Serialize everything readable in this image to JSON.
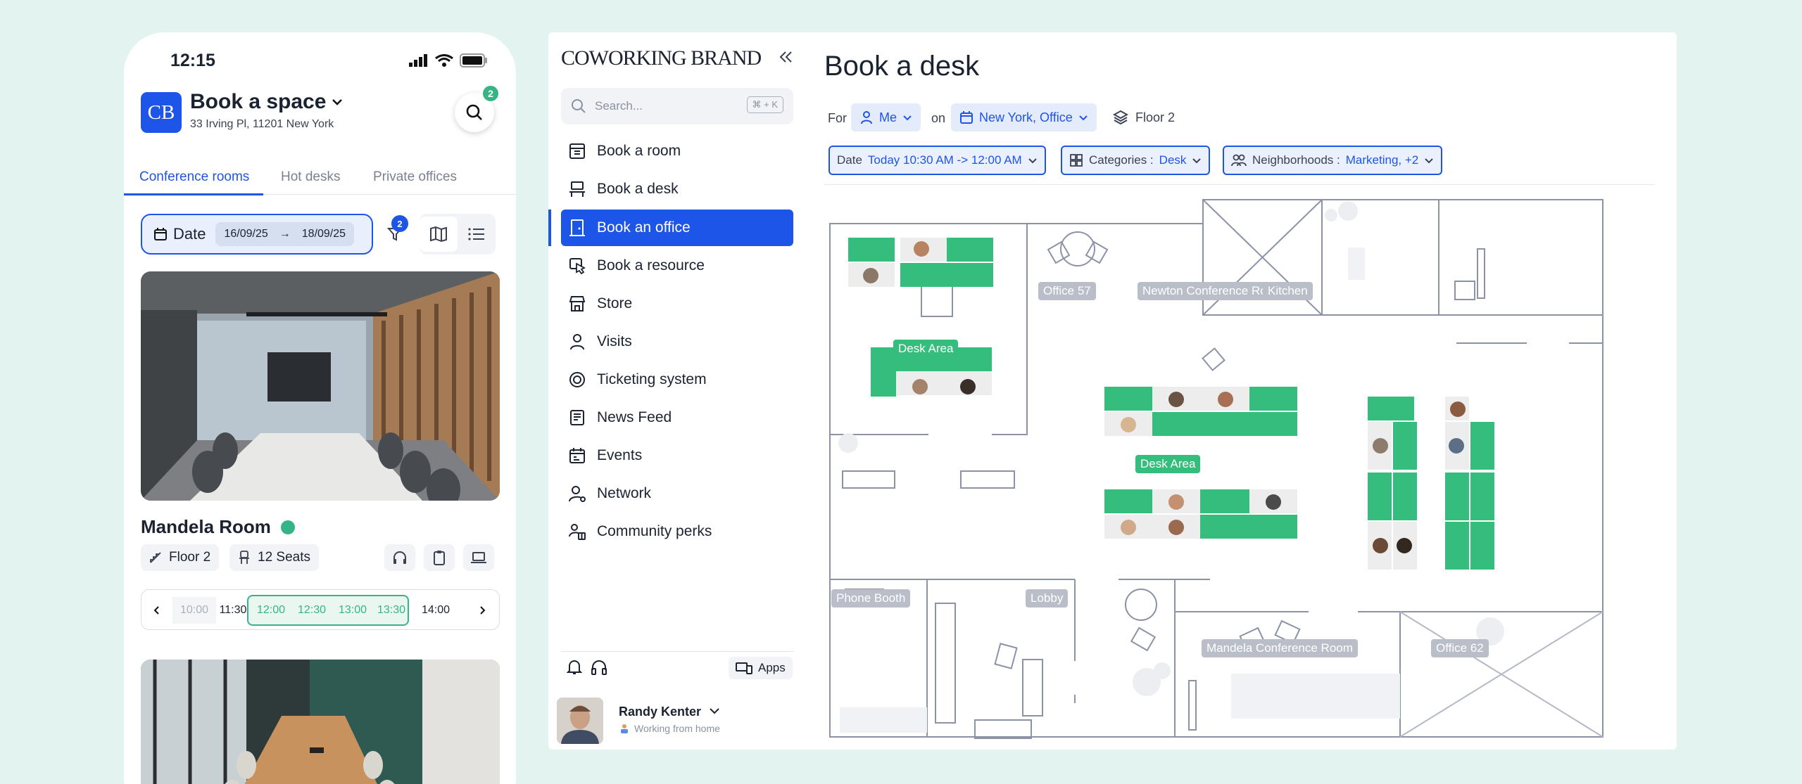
{
  "phone": {
    "time": "12:15",
    "logo": "CB",
    "title": "Book a space",
    "address": "33 Irving Pl, 11201 New York",
    "search_badge": "2",
    "tabs": [
      {
        "label": "Conference rooms",
        "active": true
      },
      {
        "label": "Hot desks",
        "active": false
      },
      {
        "label": "Private offices",
        "active": false
      }
    ],
    "date_label": "Date",
    "date_from": "16/09/25",
    "date_arrow": "→",
    "date_to": "18/09/25",
    "filter_badge": "2",
    "room": {
      "name": "Mandela Room",
      "floor": "Floor 2",
      "seats": "12 Seats"
    },
    "time_slots": [
      "10:00",
      "11:30",
      "12:00",
      "12:30",
      "13:00",
      "13:30",
      "14:00"
    ],
    "selected_slots": [
      "12:00",
      "12:30",
      "13:00",
      "13:30"
    ],
    "colors": {
      "accent": "#1d55e8",
      "available": "#35b585"
    }
  },
  "sidebar": {
    "brand": "COWORKING BRAND",
    "search_placeholder": "Search...",
    "search_shortcut": "⌘ + K",
    "items": [
      {
        "label": "Book a room",
        "icon": "calendar-grid-icon"
      },
      {
        "label": "Book a desk",
        "icon": "desk-icon"
      },
      {
        "label": "Book an office",
        "icon": "door-icon",
        "active": true
      },
      {
        "label": "Book a resource",
        "icon": "hand-pointer-icon"
      },
      {
        "label": "Store",
        "icon": "store-icon"
      },
      {
        "label": "Visits",
        "icon": "user-icon"
      },
      {
        "label": "Ticketing system",
        "icon": "lifebuoy-icon"
      },
      {
        "label": "News Feed",
        "icon": "newspaper-icon"
      },
      {
        "label": "Events",
        "icon": "calendar-icon"
      },
      {
        "label": "Network",
        "icon": "user-network-icon"
      },
      {
        "label": "Community perks",
        "icon": "gift-people-icon"
      }
    ],
    "apps_label": "Apps",
    "user": {
      "name": "Randy Kenter",
      "status": "Working from home"
    }
  },
  "main": {
    "title": "Book a desk",
    "filters": {
      "for_label": "For",
      "for_value": "Me",
      "on_label": "on",
      "location": "New York, Office",
      "floor": "Floor 2",
      "date_label": "Date",
      "date_value": "Today 10:30 AM -> 12:00 AM",
      "categories_label": "Categories :",
      "categories_value": "Desk",
      "neighborhoods_label": "Neighborhoods :",
      "neighborhoods_value": "Marketing, +2"
    },
    "floorplan_labels": {
      "office57": "Office 57",
      "newton": "Newton Conference Room",
      "kitchen": "Kitchen",
      "desk_area_1": "Desk Area",
      "desk_area_2": "Desk Area",
      "phone_booth": "Phone Booth",
      "lobby": "Lobby",
      "mandela": "Mandela Conference Room",
      "office62": "Office 62"
    },
    "colors": {
      "available_desk": "#34bd7d",
      "wall": "#8d93a6"
    }
  }
}
